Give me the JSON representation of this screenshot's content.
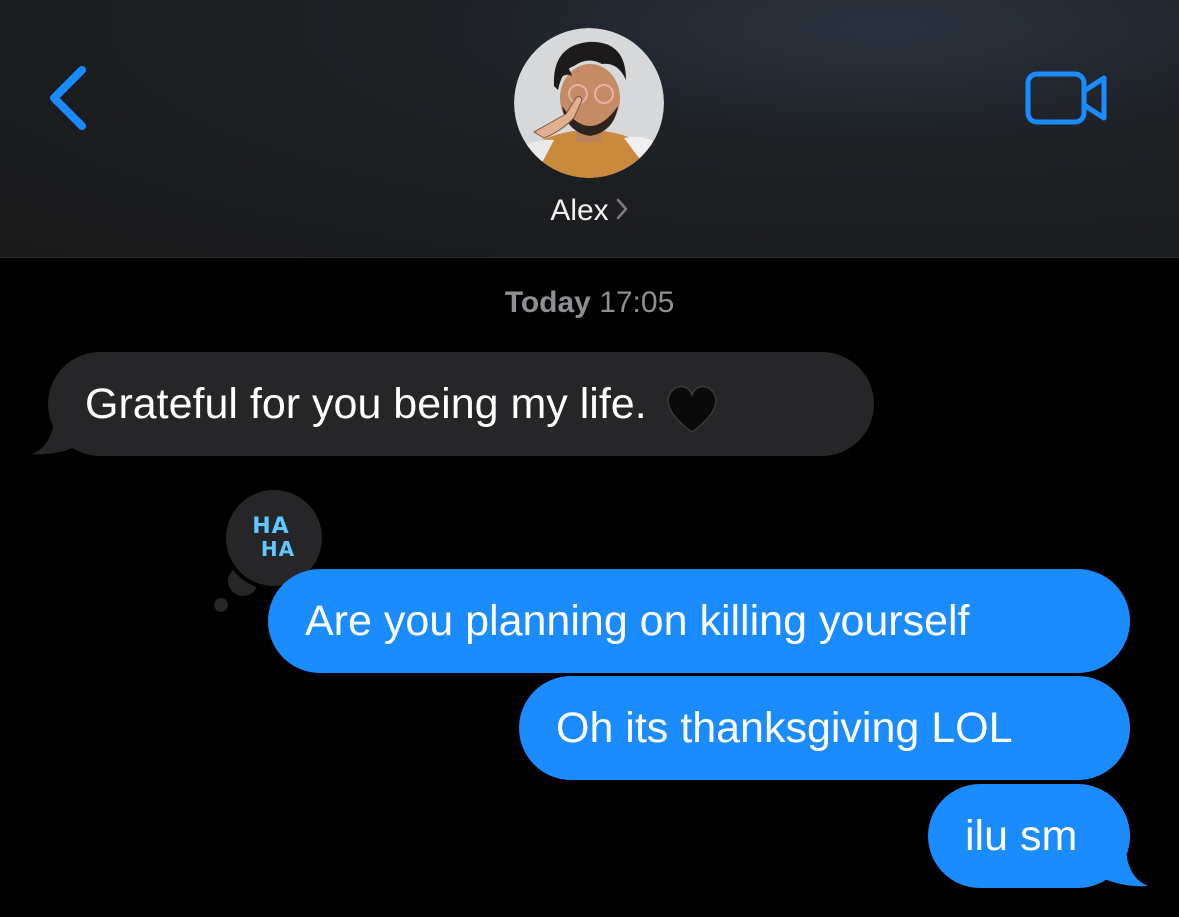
{
  "header": {
    "contact_name": "Alex",
    "back_icon": "chevron-left-icon",
    "video_icon": "video-camera-icon",
    "accent_color": "#1a8cff"
  },
  "thread": {
    "timestamp_day": "Today",
    "timestamp_time": "17:05"
  },
  "messages": [
    {
      "direction": "incoming",
      "text": "Grateful for you being my life.",
      "emoji": "black-heart"
    },
    {
      "direction": "outgoing",
      "text": "Are you planning on killing yourself",
      "tapback": "HA HA"
    },
    {
      "direction": "outgoing",
      "text": "Oh its thanksgiving LOL"
    },
    {
      "direction": "outgoing",
      "text": "ilu sm"
    }
  ],
  "tapback": {
    "line1": "HA",
    "line2": "HA"
  },
  "colors": {
    "incoming_bubble": "#262628",
    "outgoing_bubble": "#1a8cff",
    "background": "#000000"
  }
}
